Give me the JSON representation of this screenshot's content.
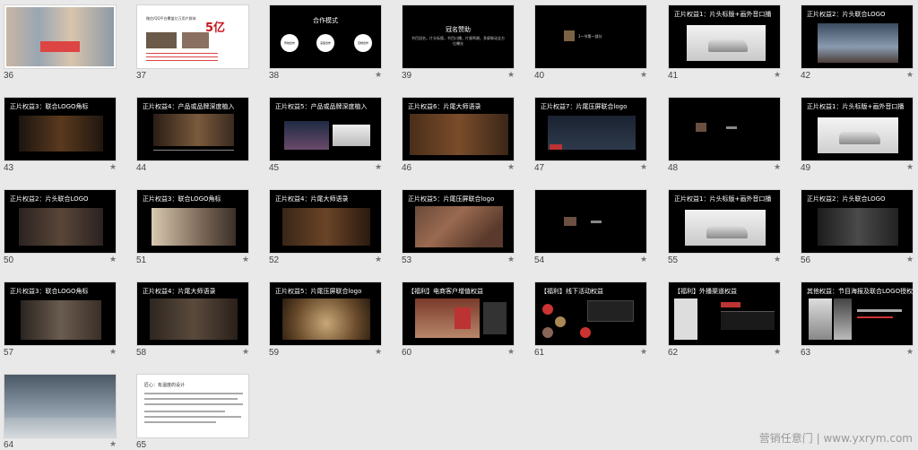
{
  "slides": [
    {
      "num": "36"
    },
    {
      "num": "37",
      "text_big": "5亿",
      "caption": "微信/QQ平台覆盖亿万用户群体"
    },
    {
      "num": "38",
      "title": "合作模式",
      "star": true,
      "circles": [
        "传统合作",
        "深度合作",
        "定制合作"
      ]
    },
    {
      "num": "39",
      "title": "冠名赞助",
      "star": true,
      "body": "节目冠名，片头标版，节目口播，片尾鸣谢，多屏联动全方位曝光"
    },
    {
      "num": "40",
      "star": true,
      "label": "1一节第一部分"
    },
    {
      "num": "41",
      "title": "正片权益1：片头标版+画外音口播",
      "star": true
    },
    {
      "num": "42",
      "title": "正片权益2：片头联合LOGO",
      "star": true
    },
    {
      "num": "43",
      "title": "正片权益3：联合LOGO角标",
      "star": true
    },
    {
      "num": "44",
      "title": "正片权益4：产品或品牌深度植入",
      "star": true
    },
    {
      "num": "45",
      "title": "正片权益5：产品或品牌深度植入",
      "star": true
    },
    {
      "num": "46",
      "title": "正片权益6：片尾大师语录",
      "star": true
    },
    {
      "num": "47",
      "title": "正片权益7：片尾压屏联合logo",
      "star": true
    },
    {
      "num": "48",
      "star": true
    },
    {
      "num": "49",
      "title": "正片权益1：片头标版+画外音口播",
      "star": true
    },
    {
      "num": "50",
      "title": "正片权益2：片头联合LOGO",
      "star": true
    },
    {
      "num": "51",
      "title": "正片权益3：联合LOGO角标",
      "star": true
    },
    {
      "num": "52",
      "title": "正片权益4：片尾大师语录",
      "star": true
    },
    {
      "num": "53",
      "title": "正片权益5：片尾压屏联合logo",
      "star": true
    },
    {
      "num": "54",
      "star": true
    },
    {
      "num": "55",
      "title": "正片权益1：片头标版+画外音口播",
      "star": true
    },
    {
      "num": "56",
      "title": "正片权益2：片头联合LOGO",
      "star": true
    },
    {
      "num": "57",
      "title": "正片权益3：联合LOGO角标",
      "star": true
    },
    {
      "num": "58",
      "title": "正片权益4：片尾大师语录",
      "star": true
    },
    {
      "num": "59",
      "title": "正片权益5：片尾压屏联合logo",
      "star": true
    },
    {
      "num": "60",
      "title": "【福利】电商客户增值权益",
      "star": true
    },
    {
      "num": "61",
      "title": "【福利】线下活动权益",
      "star": true
    },
    {
      "num": "62",
      "title": "【福利】外播渠道权益",
      "star": true
    },
    {
      "num": "63",
      "title": "其他权益：节目海报及联合LOGO授权",
      "star": true
    },
    {
      "num": "64",
      "star": true
    },
    {
      "num": "65",
      "title": "匠心：有温度的设计"
    }
  ],
  "watermark": "营销任意门 | www.yxrym.com"
}
